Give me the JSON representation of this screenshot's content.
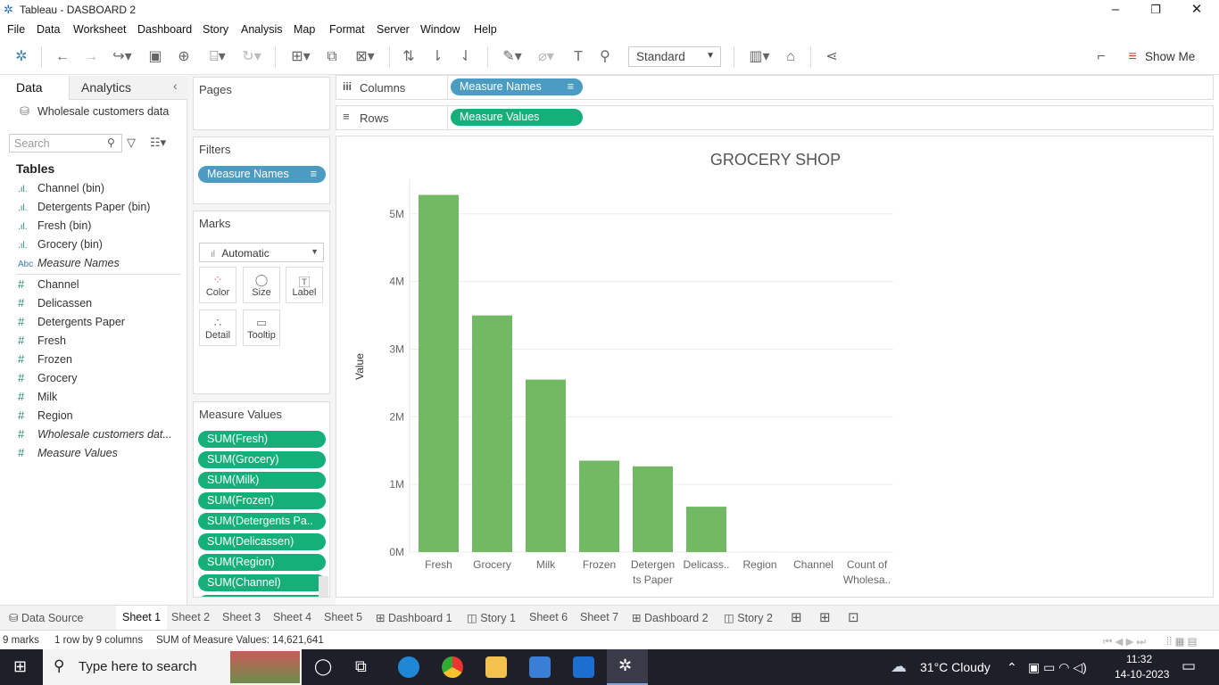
{
  "window": {
    "title": "Tableau - DASBOARD 2"
  },
  "menu": [
    "File",
    "Data",
    "Worksheet",
    "Dashboard",
    "Story",
    "Analysis",
    "Map",
    "Format",
    "Server",
    "Window",
    "Help"
  ],
  "toolbar": {
    "fit_select": "Standard",
    "show_me": "Show Me"
  },
  "left_panel": {
    "tabs": [
      "Data",
      "Analytics"
    ],
    "datasource": "Wholesale customers data",
    "search_placeholder": "Search",
    "tables_header": "Tables",
    "fields": [
      {
        "icon": "bin",
        "name": "Channel (bin)",
        "italic": false
      },
      {
        "icon": "bin",
        "name": "Detergents Paper (bin)",
        "italic": false
      },
      {
        "icon": "bin",
        "name": "Fresh (bin)",
        "italic": false
      },
      {
        "icon": "bin",
        "name": "Grocery (bin)",
        "italic": false
      },
      {
        "icon": "Abc",
        "name": "Measure Names",
        "italic": true
      },
      {
        "icon": "#",
        "name": "Channel",
        "italic": false
      },
      {
        "icon": "#",
        "name": "Delicassen",
        "italic": false
      },
      {
        "icon": "#",
        "name": "Detergents Paper",
        "italic": false
      },
      {
        "icon": "#",
        "name": "Fresh",
        "italic": false
      },
      {
        "icon": "#",
        "name": "Frozen",
        "italic": false
      },
      {
        "icon": "#",
        "name": "Grocery",
        "italic": false
      },
      {
        "icon": "#",
        "name": "Milk",
        "italic": false
      },
      {
        "icon": "#",
        "name": "Region",
        "italic": false
      },
      {
        "icon": "#",
        "name": "Wholesale customers dat...",
        "italic": true
      },
      {
        "icon": "#",
        "name": "Measure Values",
        "italic": true
      }
    ]
  },
  "cards": {
    "pages": "Pages",
    "filters": "Filters",
    "filter_pill": "Measure Names",
    "marks": "Marks",
    "mark_type": "Automatic",
    "mark_buttons": [
      "Color",
      "Size",
      "Label",
      "Detail",
      "Tooltip"
    ],
    "measure_values_title": "Measure Values",
    "measure_values": [
      "SUM(Fresh)",
      "SUM(Grocery)",
      "SUM(Milk)",
      "SUM(Frozen)",
      "SUM(Detergents Pa..",
      "SUM(Delicassen)",
      "SUM(Region)",
      "SUM(Channel)"
    ]
  },
  "shelves": {
    "columns_label": "Columns",
    "columns_pill": "Measure Names",
    "rows_label": "Rows",
    "rows_pill": "Measure Values"
  },
  "chart_data": {
    "type": "bar",
    "title": "GROCERY SHOP",
    "ylabel": "Value",
    "xlabel": "",
    "categories": [
      "Fresh",
      "Grocery",
      "Milk",
      "Frozen",
      "Detergents Paper",
      "Delicassen",
      "Region",
      "Channel",
      "Count of Wholesale customers data"
    ],
    "category_labels": [
      [
        "Fresh"
      ],
      [
        "Grocery"
      ],
      [
        "Milk"
      ],
      [
        "Frozen"
      ],
      [
        "Detergen",
        "ts Paper"
      ],
      [
        "Delicass.."
      ],
      [
        "Region"
      ],
      [
        "Channel"
      ],
      [
        "Count of",
        "Wholesa.."
      ]
    ],
    "values": [
      5280131,
      3498562,
      2550357,
      1351650,
      1267857,
      670943,
      1117,
      642,
      440
    ],
    "yticks": [
      0,
      1000000,
      2000000,
      3000000,
      4000000,
      5000000
    ],
    "ytick_labels": [
      "0M",
      "1M",
      "2M",
      "3M",
      "4M",
      "5M"
    ],
    "ylim": [
      0,
      5300000
    ],
    "grid": true,
    "bar_color": "#71b963"
  },
  "sheet_tabs": [
    "Data Source",
    "Sheet 1",
    "Sheet 2",
    "Sheet 3",
    "Sheet 4",
    "Sheet 5",
    "Dashboard 1",
    "Story 1",
    "Sheet 6",
    "Sheet 7",
    "Dashboard 2",
    "Story 2"
  ],
  "status": {
    "marks": "9 marks",
    "dims": "1 row by 9 columns",
    "sum": "SUM of Measure Values: 14,621,641"
  },
  "taskbar": {
    "search": "Type here to search",
    "weather": "31°C  Cloudy",
    "time": "11:32",
    "date": "14-10-2023"
  }
}
